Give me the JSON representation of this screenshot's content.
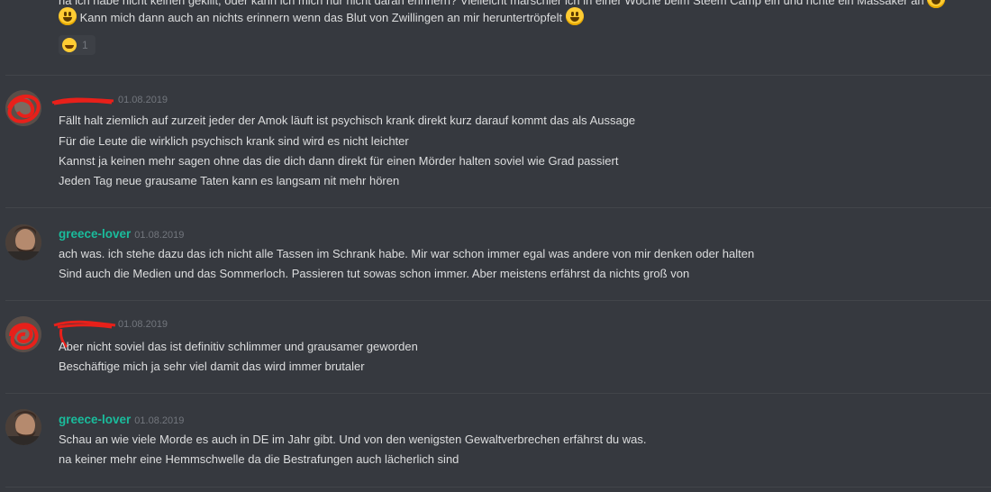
{
  "messages": [
    {
      "id": "m0",
      "lines": [
        "na ich habe nicht keinen gekillt, oder kann ich mich nur nicht daran erinnern? Vielleicht marschier ich in einer Woche beim Steem Camp ein und richte ein Massaker an",
        "Kann mich dann auch an nichts erinnern wenn das Blut von Zwillingen an mir heruntertröpfelt"
      ],
      "reaction": {
        "emoji": "joy-emoji",
        "count": "1"
      }
    },
    {
      "id": "m1",
      "username": "",
      "timestamp": "01.08.2019",
      "lines": [
        "Fällt halt ziemlich auf zurzeit jeder der Amok läuft ist psychisch krank direkt kurz darauf kommt das als Aussage",
        "Für die Leute die wirklich psychisch krank sind wird es nicht leichter",
        "Kannst ja keinen mehr sagen ohne das die dich dann direkt für einen Mörder halten soviel wie Grad passiert",
        "Jeden Tag neue grausame Taten  kann es langsam nit mehr hören"
      ]
    },
    {
      "id": "m2",
      "username": "greece-lover",
      "timestamp": "01.08.2019",
      "lines": [
        "ach was. ich stehe dazu das ich nicht alle Tassen im Schrank habe. Mir war schon immer egal was andere von mir denken oder halten",
        "Sind auch die Medien und das Sommerloch. Passieren tut sowas schon immer. Aber meistens erfährst da nichts groß von"
      ]
    },
    {
      "id": "m3",
      "username": "",
      "timestamp": "01.08.2019",
      "lines": [
        "Aber nicht soviel das ist definitiv schlimmer und grausamer geworden",
        "Beschäftige mich ja sehr viel damit das wird immer brutaler"
      ]
    },
    {
      "id": "m4",
      "username": "greece-lover",
      "timestamp": "01.08.2019",
      "lines": [
        "Schau an wie viele Morde  es auch in DE im Jahr gibt. Und von den wenigsten Gewaltverbrechen erfährst du was.",
        "na keiner mehr eine Hemmschwelle da die Bestrafungen auch lächerlich sind"
      ]
    }
  ],
  "colors": {
    "background": "#36393f",
    "text": "#dcddde",
    "username_teal": "#1abc9c",
    "timestamp": "#72767d",
    "redaction": "#e8201a"
  }
}
